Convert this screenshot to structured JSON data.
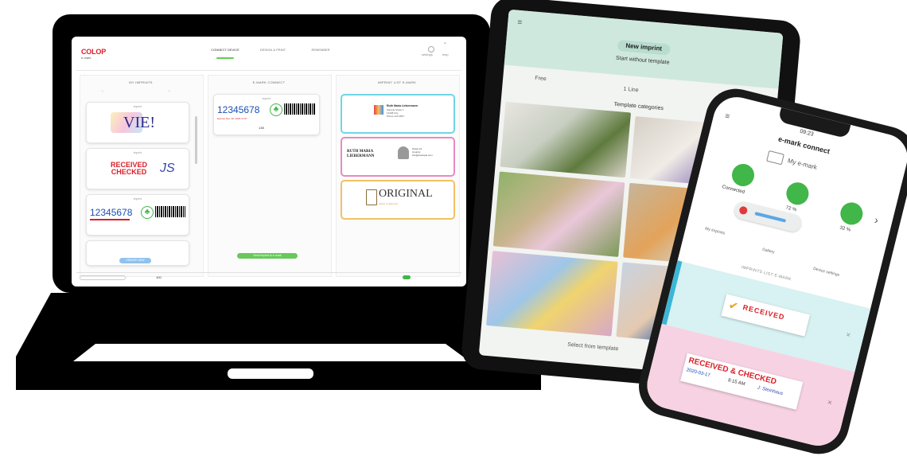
{
  "laptop": {
    "brand": "COLOP",
    "brand_sub": "e-mark",
    "tabs": [
      "CONNECT DEVICE",
      "DESIGN & PRINT",
      "REMEMBER"
    ],
    "top_right": [
      "settings",
      "help"
    ],
    "columns": [
      {
        "title": "MY IMPRINTS"
      },
      {
        "title": "E-MARK CONNECT"
      },
      {
        "title": "IMPRINT LIST E-MARK"
      }
    ],
    "col1_cards": [
      {
        "label": "imprint",
        "text": "VIE!"
      },
      {
        "label": "imprint",
        "text1": "RECEIVED",
        "text2": "CHECKED",
        "signature": "JS"
      },
      {
        "label": "imprint",
        "number": "12345678"
      }
    ],
    "col1_button": "CREATE NEW",
    "col2_card": {
      "label": "imprint",
      "number": "12345678",
      "date": "Expires Nov. 30, 2020 17:07",
      "count": "138"
    },
    "col2_button": "Send imprint to e-mark",
    "col3_cards": [
      {
        "name": "Ruth Maria Liebermann",
        "lines": [
          "Sample Street 1",
          "12345 City",
          "Phone 123 4567"
        ]
      },
      {
        "name": "RUTH MARIA LIEBERMANN",
        "lines": [
          "Street 12",
          "Country",
          "info@example.com"
        ]
      },
      {
        "text": "ORIGINAL",
        "sub": "stamp of approval"
      }
    ],
    "status": [
      "",
      "100",
      "",
      "",
      "",
      "",
      ""
    ]
  },
  "tablet": {
    "title": "New imprint",
    "subtitle": "Start without template",
    "options": [
      "Free",
      "1 Line",
      ""
    ],
    "section_title": "Template categories",
    "bottom_button": "Select from template"
  },
  "phone": {
    "time": "09:23",
    "title": "e-mark connect",
    "device": "My e-mark",
    "status_items": [
      "Connected",
      "72 %",
      "32 %"
    ],
    "menu": [
      "My imprints",
      "Gallery",
      "Device settings"
    ],
    "list_title": "IMPRINTS LIST E-MARK",
    "stamp1": "RECEIVED",
    "stamp2_main": "RECEIVED & CHECKED",
    "stamp2_date": "2020-03-17",
    "stamp2_time": "8:15 AM",
    "stamp2_sig": "J. Steinhaus"
  },
  "colors": {
    "brand_red": "#d91e28",
    "accent_green": "#67c95b",
    "barcode_blue": "#1a4fb5",
    "cyan_frame": "#6fd6e6",
    "pink_frame": "#e68bc1",
    "orange_frame": "#f3c164"
  }
}
